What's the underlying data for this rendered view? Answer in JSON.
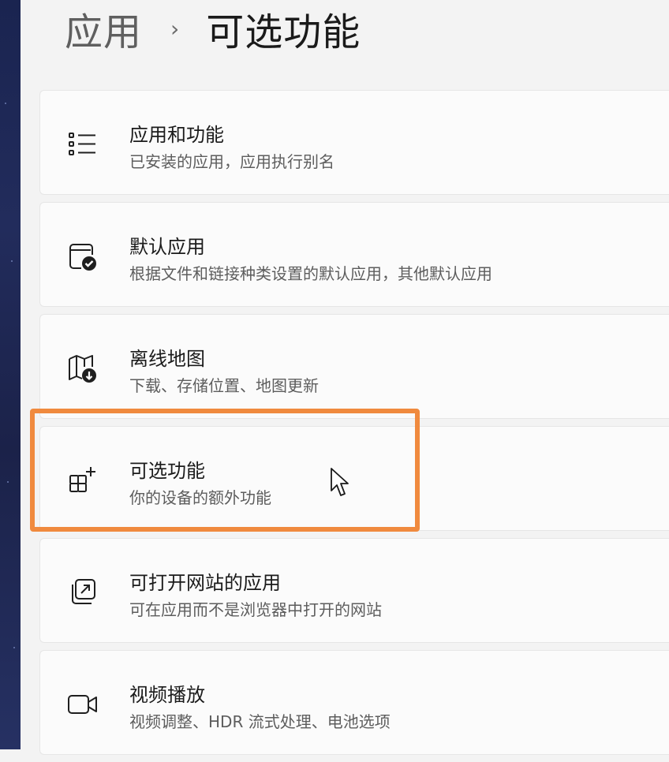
{
  "breadcrumb": {
    "parent": "应用",
    "separator": "›",
    "current": "可选功能"
  },
  "items": [
    {
      "title": "应用和功能",
      "description": "已安装的应用，应用执行别名",
      "icon": "list-icon"
    },
    {
      "title": "默认应用",
      "description": "根据文件和链接种类设置的默认应用，其他默认应用",
      "icon": "default-apps-icon"
    },
    {
      "title": "离线地图",
      "description": "下载、存储位置、地图更新",
      "icon": "offline-map-icon"
    },
    {
      "title": "可选功能",
      "description": "你的设备的额外功能",
      "icon": "add-apps-icon",
      "highlighted": true
    },
    {
      "title": "可打开网站的应用",
      "description": "可在应用而不是浏览器中打开的网站",
      "icon": "open-link-icon"
    },
    {
      "title": "视频播放",
      "description": "视频调整、HDR 流式处理、电池选项",
      "icon": "video-icon"
    }
  ],
  "colors": {
    "highlight_border": "#f08a3e",
    "page_background": "#f3f3f3",
    "card_background": "#fbfbfb"
  }
}
